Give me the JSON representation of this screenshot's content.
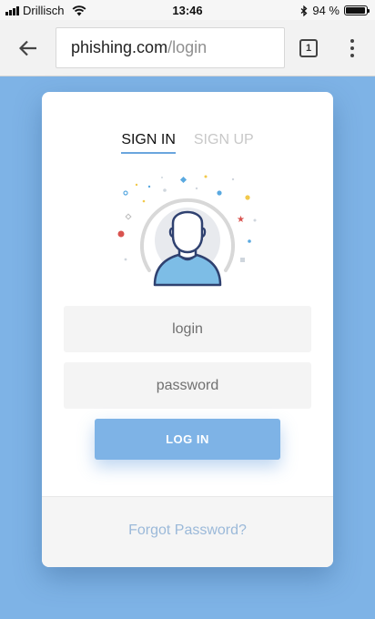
{
  "status_bar": {
    "carrier": "Drillisch",
    "time": "13:46",
    "battery": "94 %",
    "battery_level": 0.94,
    "icons": [
      "signal-icon",
      "wifi-icon",
      "bluetooth-icon",
      "battery-icon"
    ]
  },
  "browser": {
    "url_host": "phishing.com",
    "url_path": "/login",
    "tab_count": "1",
    "icons": [
      "back-arrow-icon",
      "tabs-icon",
      "more-menu-icon"
    ]
  },
  "login_form": {
    "tabs": [
      {
        "label": "SIGN IN",
        "active": true
      },
      {
        "label": "SIGN UP",
        "active": false
      }
    ],
    "login_placeholder": "login",
    "password_placeholder": "password",
    "submit_label": "LOG IN",
    "forgot_label": "Forgot Password?",
    "avatar_icon": "user-avatar-icon"
  },
  "colors": {
    "background": "#7eb3e6",
    "accent": "#7eb3e6",
    "tab_underline": "#6aa6de",
    "link": "#9bb9d9",
    "avatar_shirt": "#7dbde6",
    "avatar_outline": "#2f4170"
  }
}
